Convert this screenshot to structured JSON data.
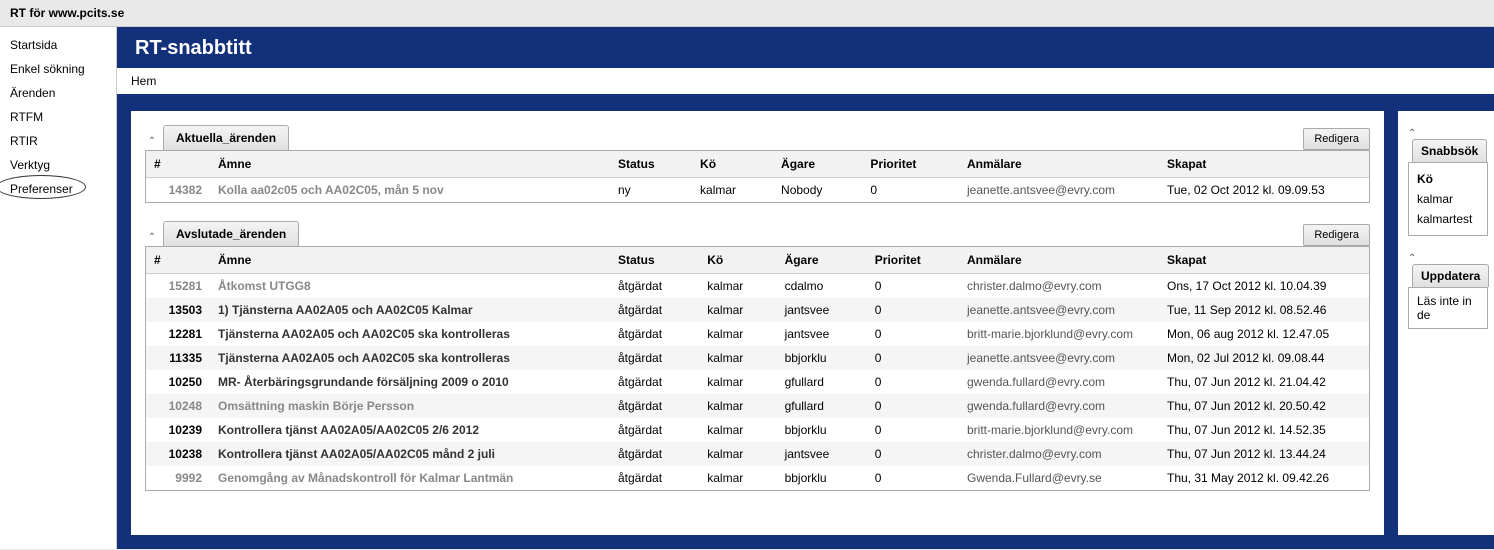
{
  "app_title": "RT för www.pcits.se",
  "page_title": "RT-snabbtitt",
  "breadcrumb": "Hem",
  "sidebar": {
    "items": [
      {
        "label": "Startsida"
      },
      {
        "label": "Enkel sökning"
      },
      {
        "label": "Ärenden"
      },
      {
        "label": "RTFM"
      },
      {
        "label": "RTIR"
      },
      {
        "label": "Verktyg"
      },
      {
        "label": "Preferenser",
        "circled": true
      }
    ]
  },
  "columns": {
    "id": "#",
    "subject": "Ämne",
    "status": "Status",
    "queue": "Kö",
    "owner": "Ägare",
    "priority": "Prioritet",
    "reporter": "Anmälare",
    "created": "Skapat"
  },
  "panels": {
    "current": {
      "title": "Aktuella_ärenden",
      "edit": "Redigera",
      "rows": [
        {
          "id": "14382",
          "subject": "Kolla aa02c05 och AA02C05, mån 5 nov",
          "status": "ny",
          "queue": "kalmar",
          "owner": "Nobody",
          "priority": "0",
          "reporter": "jeanette.antsvee@evry.com",
          "created": "Tue, 02 Oct 2012 kl. 09.09.53",
          "muted": true
        }
      ]
    },
    "closed": {
      "title": "Avslutade_ärenden",
      "edit": "Redigera",
      "rows": [
        {
          "id": "15281",
          "subject": "Åtkomst UTGG8",
          "status": "åtgärdat",
          "queue": "kalmar",
          "owner": "cdalmo",
          "priority": "0",
          "reporter": "christer.dalmo@evry.com",
          "created": "Ons, 17 Oct 2012 kl. 10.04.39",
          "muted": true
        },
        {
          "id": "13503",
          "subject": "1) Tjänsterna AA02A05 och AA02C05 Kalmar",
          "status": "åtgärdat",
          "queue": "kalmar",
          "owner": "jantsvee",
          "priority": "0",
          "reporter": "jeanette.antsvee@evry.com",
          "created": "Tue, 11 Sep 2012 kl. 08.52.46"
        },
        {
          "id": "12281",
          "subject": "Tjänsterna AA02A05 och AA02C05 ska kontrolleras",
          "status": "åtgärdat",
          "queue": "kalmar",
          "owner": "jantsvee",
          "priority": "0",
          "reporter": "britt-marie.bjorklund@evry.com",
          "created": "Mon, 06 aug 2012 kl. 12.47.05"
        },
        {
          "id": "11335",
          "subject": "Tjänsterna AA02A05 och AA02C05 ska kontrolleras",
          "status": "åtgärdat",
          "queue": "kalmar",
          "owner": "bbjorklu",
          "priority": "0",
          "reporter": "jeanette.antsvee@evry.com",
          "created": "Mon, 02 Jul 2012 kl. 09.08.44"
        },
        {
          "id": "10250",
          "subject": "MR- Återbäringsgrundande försäljning 2009 o 2010",
          "status": "åtgärdat",
          "queue": "kalmar",
          "owner": "gfullard",
          "priority": "0",
          "reporter": "gwenda.fullard@evry.com",
          "created": "Thu, 07 Jun 2012 kl. 21.04.42"
        },
        {
          "id": "10248",
          "subject": "Omsättning maskin Börje Persson",
          "status": "åtgärdat",
          "queue": "kalmar",
          "owner": "gfullard",
          "priority": "0",
          "reporter": "gwenda.fullard@evry.com",
          "created": "Thu, 07 Jun 2012 kl. 20.50.42",
          "muted": true
        },
        {
          "id": "10239",
          "subject": "Kontrollera tjänst AA02A05/AA02C05 2/6 2012",
          "status": "åtgärdat",
          "queue": "kalmar",
          "owner": "bbjorklu",
          "priority": "0",
          "reporter": "britt-marie.bjorklund@evry.com",
          "created": "Thu, 07 Jun 2012 kl. 14.52.35"
        },
        {
          "id": "10238",
          "subject": "Kontrollera tjänst AA02A05/AA02C05 månd 2 juli",
          "status": "åtgärdat",
          "queue": "kalmar",
          "owner": "jantsvee",
          "priority": "0",
          "reporter": "christer.dalmo@evry.com",
          "created": "Thu, 07 Jun 2012 kl. 13.44.24"
        },
        {
          "id": "9992",
          "subject": "Genomgång av Månadskontroll för Kalmar Lantmän",
          "status": "åtgärdat",
          "queue": "kalmar",
          "owner": "bbjorklu",
          "priority": "0",
          "reporter": "Gwenda.Fullard@evry.se",
          "created": "Thu, 31 May 2012 kl. 09.42.26",
          "muted": true
        }
      ]
    }
  },
  "right": {
    "quicksearch": {
      "title": "Snabbsök",
      "queue_label": "Kö",
      "queues": [
        "kalmar",
        "kalmartest"
      ]
    },
    "refresh": {
      "title": "Uppdatera",
      "text": "Läs inte in de"
    }
  }
}
